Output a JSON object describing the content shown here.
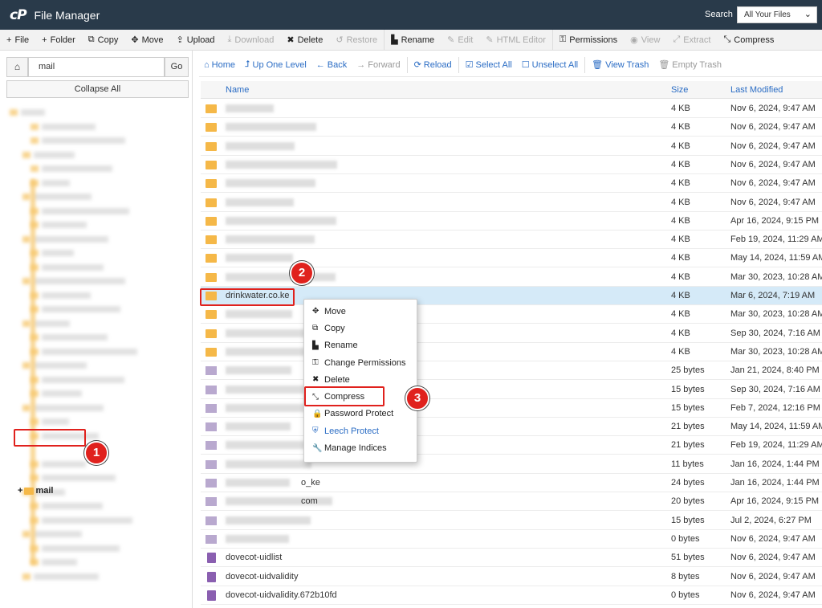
{
  "header": {
    "logo": "cP",
    "title": "File Manager",
    "search_label": "Search",
    "search_scope": "All Your Files"
  },
  "toolbar": [
    {
      "label": "File",
      "icon": "plus-icon",
      "glyph": "+",
      "disabled": false
    },
    {
      "label": "Folder",
      "icon": "plus-icon",
      "glyph": "+",
      "disabled": false
    },
    {
      "label": "Copy",
      "icon": "copy-icon",
      "glyph": "⧉",
      "disabled": false
    },
    {
      "label": "Move",
      "icon": "move-icon",
      "glyph": "✥",
      "disabled": false
    },
    {
      "label": "Upload",
      "icon": "upload-icon",
      "glyph": "⇪",
      "disabled": false
    },
    {
      "label": "Download",
      "icon": "download-icon",
      "glyph": "⤓",
      "disabled": true
    },
    {
      "label": "Delete",
      "icon": "close-icon",
      "glyph": "✖",
      "disabled": false
    },
    {
      "label": "Restore",
      "icon": "restore-icon",
      "glyph": "↺",
      "disabled": true
    },
    {
      "label": "Rename",
      "icon": "file-icon",
      "glyph": "▙",
      "disabled": false
    },
    {
      "label": "Edit",
      "icon": "pencil-icon",
      "glyph": "✎",
      "disabled": true
    },
    {
      "label": "HTML Editor",
      "icon": "html-editor-icon",
      "glyph": "✎",
      "disabled": true
    },
    {
      "label": "Permissions",
      "icon": "key-icon",
      "glyph": "⚿",
      "disabled": false
    },
    {
      "label": "View",
      "icon": "eye-icon",
      "glyph": "◉",
      "disabled": true
    },
    {
      "label": "Extract",
      "icon": "expand-icon",
      "glyph": "⤢",
      "disabled": true
    },
    {
      "label": "Compress",
      "icon": "compress-icon",
      "glyph": "⤡",
      "disabled": false
    }
  ],
  "left": {
    "path_value": "mail",
    "go_label": "Go",
    "collapse_label": "Collapse All",
    "tree_mail_label": "mail",
    "tree_mail_prefix": "+"
  },
  "nav": [
    {
      "label": "Home",
      "icon": "home-icon",
      "glyph": "⌂",
      "disabled": false
    },
    {
      "label": "Up One Level",
      "icon": "level-up-icon",
      "glyph": "⮥",
      "disabled": false
    },
    {
      "label": "Back",
      "icon": "arrow-left-icon",
      "glyph": "←",
      "disabled": false
    },
    {
      "label": "Forward",
      "icon": "arrow-right-icon",
      "glyph": "→",
      "disabled": true
    },
    {
      "label": "Reload",
      "icon": "reload-icon",
      "glyph": "⟳",
      "disabled": false
    },
    {
      "label": "Select All",
      "icon": "check-square-icon",
      "glyph": "☑",
      "disabled": false
    },
    {
      "label": "Unselect All",
      "icon": "square-icon",
      "glyph": "☐",
      "disabled": false
    },
    {
      "label": "View Trash",
      "icon": "trash-icon",
      "glyph": "🗑",
      "disabled": false
    },
    {
      "label": "Empty Trash",
      "icon": "trash-icon",
      "glyph": "🗑",
      "disabled": true
    }
  ],
  "table": {
    "columns": {
      "name": "Name",
      "size": "Size",
      "modified": "Last Modified"
    },
    "rows": [
      {
        "name": "",
        "size": "4 KB",
        "modified": "Nov 6, 2024, 9:47 AM",
        "type": "folder"
      },
      {
        "name": "",
        "size": "4 KB",
        "modified": "Nov 6, 2024, 9:47 AM",
        "type": "folder"
      },
      {
        "name": "",
        "size": "4 KB",
        "modified": "Nov 6, 2024, 9:47 AM",
        "type": "folder"
      },
      {
        "name": "",
        "size": "4 KB",
        "modified": "Nov 6, 2024, 9:47 AM",
        "type": "folder"
      },
      {
        "name": "",
        "size": "4 KB",
        "modified": "Nov 6, 2024, 9:47 AM",
        "type": "folder"
      },
      {
        "name": "",
        "size": "4 KB",
        "modified": "Nov 6, 2024, 9:47 AM",
        "type": "folder"
      },
      {
        "name": "",
        "size": "4 KB",
        "modified": "Apr 16, 2024, 9:15 PM",
        "type": "folder"
      },
      {
        "name": "",
        "size": "4 KB",
        "modified": "Feb 19, 2024, 11:29 AM",
        "type": "folder"
      },
      {
        "name": "",
        "size": "4 KB",
        "modified": "May 14, 2024, 11:59 AM",
        "type": "folder"
      },
      {
        "name": "",
        "size": "4 KB",
        "modified": "Mar 30, 2023, 10:28 AM",
        "type": "folder"
      },
      {
        "name": "drinkwater.co.ke",
        "size": "4 KB",
        "modified": "Mar 6, 2024, 7:19 AM",
        "type": "folder",
        "selected": true
      },
      {
        "name": "",
        "size": "4 KB",
        "modified": "Mar 30, 2023, 10:28 AM",
        "type": "folder"
      },
      {
        "name": "",
        "size": "4 KB",
        "modified": "Sep 30, 2024, 7:16 AM",
        "type": "folder"
      },
      {
        "name": "",
        "size": "4 KB",
        "modified": "Mar 30, 2023, 10:28 AM",
        "type": "folder"
      },
      {
        "name": "",
        "size": "25 bytes",
        "modified": "Jan 21, 2024, 8:40 PM",
        "type": "file"
      },
      {
        "name": "",
        "size": "15 bytes",
        "modified": "Sep 30, 2024, 7:16 AM",
        "type": "file"
      },
      {
        "name": "",
        "size": "15 bytes",
        "modified": "Feb 7, 2024, 12:16 PM",
        "type": "file"
      },
      {
        "name": "",
        "size": "21 bytes",
        "modified": "May 14, 2024, 11:59 AM",
        "type": "file"
      },
      {
        "name": "",
        "size": "21 bytes",
        "modified": "Feb 19, 2024, 11:29 AM",
        "type": "file"
      },
      {
        "name": "",
        "size": "11 bytes",
        "modified": "Jan 16, 2024, 1:44 PM",
        "type": "file"
      },
      {
        "name": "o_ke",
        "size": "24 bytes",
        "modified": "Jan 16, 2024, 1:44 PM",
        "type": "file"
      },
      {
        "name": "com",
        "size": "20 bytes",
        "modified": "Apr 16, 2024, 9:15 PM",
        "type": "file"
      },
      {
        "name": "",
        "size": "15 bytes",
        "modified": "Jul 2, 2024, 6:27 PM",
        "type": "file"
      },
      {
        "name": "",
        "size": "0 bytes",
        "modified": "Nov 6, 2024, 9:47 AM",
        "type": "file"
      },
      {
        "name": "dovecot-uidlist",
        "size": "51 bytes",
        "modified": "Nov 6, 2024, 9:47 AM",
        "type": "doc"
      },
      {
        "name": "dovecot-uidvalidity",
        "size": "8 bytes",
        "modified": "Nov 6, 2024, 9:47 AM",
        "type": "doc"
      },
      {
        "name": "dovecot-uidvalidity.672b10fd",
        "size": "0 bytes",
        "modified": "Nov 6, 2024, 9:47 AM",
        "type": "doc"
      }
    ]
  },
  "context_menu": [
    {
      "label": "Move",
      "icon": "move-icon",
      "glyph": "✥"
    },
    {
      "label": "Copy",
      "icon": "copy-icon",
      "glyph": "⧉"
    },
    {
      "label": "Rename",
      "icon": "file-icon",
      "glyph": "▙"
    },
    {
      "label": "Change Permissions",
      "icon": "key-icon",
      "glyph": "⚿"
    },
    {
      "label": "Delete",
      "icon": "close-icon",
      "glyph": "✖"
    },
    {
      "label": "Compress",
      "icon": "compress-icon",
      "glyph": "⤡"
    },
    {
      "label": "Password Protect",
      "icon": "lock-icon",
      "glyph": "🔒"
    },
    {
      "label": "Leech Protect",
      "icon": "shield-icon",
      "glyph": "⛨",
      "link": true
    },
    {
      "label": "Manage Indices",
      "icon": "wrench-icon",
      "glyph": "🔧"
    }
  ],
  "annotations": [
    "1",
    "2",
    "3"
  ],
  "colors": {
    "header_bg": "#293a4a",
    "accent": "#2a6cc4",
    "highlight": "#e0211d",
    "folder": "#f5b848",
    "selected_row": "#d5eaf8"
  }
}
